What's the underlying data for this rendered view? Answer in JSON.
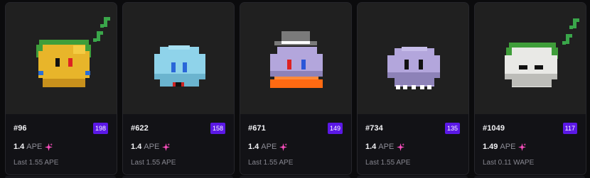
{
  "cards": [
    {
      "token_id": "#96",
      "rank": "198",
      "price": "1.4",
      "currency": "APE",
      "last_sale": "Last 1.55 APE",
      "art": {
        "body": "#e8b52a",
        "shade": "#c8911c",
        "hat": "#3f9e3a",
        "hat_dark": "#2d7d2d",
        "eye": "#111111",
        "eye_accent": "#d22",
        "cheek": "#2a6fd6",
        "note": "#3aa64a"
      }
    },
    {
      "token_id": "#622",
      "rank": "158",
      "price": "1.4",
      "currency": "APE",
      "last_sale": "Last 1.55 APE",
      "art": {
        "body": "#8fd3ea",
        "shade": "#6bb4cf",
        "eye": "#2a66d8",
        "mouth": "#cc2222"
      }
    },
    {
      "token_id": "#671",
      "rank": "149",
      "price": "1.4",
      "currency": "APE",
      "last_sale": "Last 1.55 APE",
      "art": {
        "body": "#b3a6dc",
        "shade": "#8d82b8",
        "hat": "#7a7a7a",
        "hat_band": "#ffffff",
        "eye": "#d22",
        "eye2": "#2a56d8",
        "skirt": "#ff6a12"
      }
    },
    {
      "token_id": "#734",
      "rank": "135",
      "price": "1.4",
      "currency": "APE",
      "last_sale": "Last 1.55 APE",
      "art": {
        "body": "#b3a6dc",
        "shade": "#8d82b8",
        "eye": "#111111",
        "teeth": "#ffffff"
      }
    },
    {
      "token_id": "#1049",
      "rank": "117",
      "price": "1.49",
      "currency": "APE",
      "last_sale": "Last 0.11 WAPE",
      "art": {
        "body": "#e9e9e6",
        "shade": "#bdbdb9",
        "hat": "#3f9e3a",
        "eye": "#111111",
        "note": "#3aa64a"
      }
    }
  ],
  "colors": {
    "badge": "#5b18e6",
    "sparkle": "#ff4fc1"
  }
}
